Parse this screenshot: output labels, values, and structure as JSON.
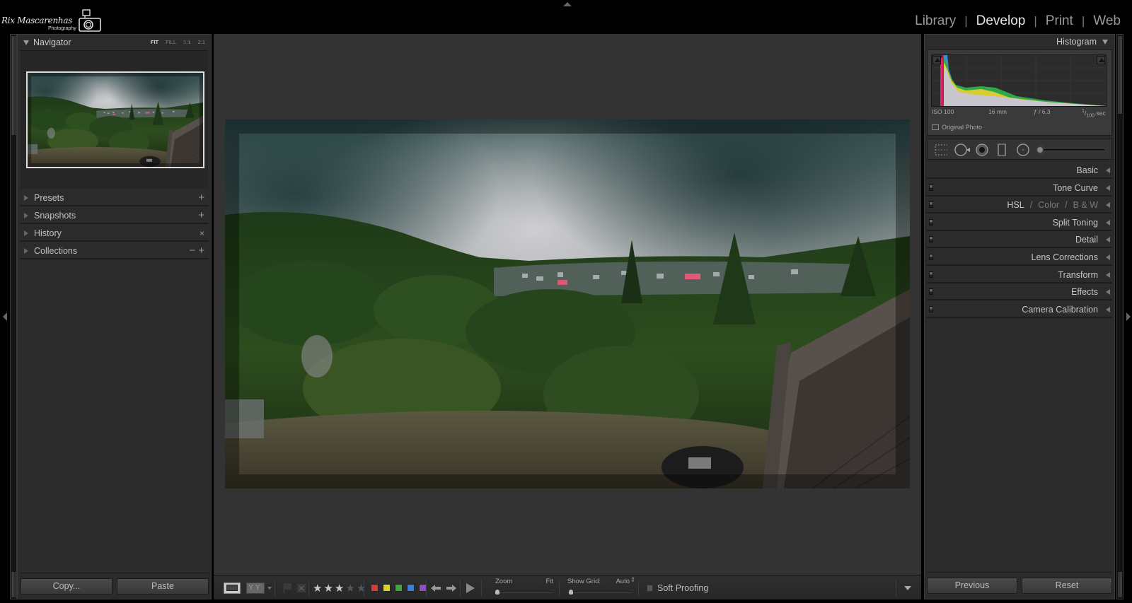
{
  "app": {
    "logo_name": "Rix Mascarenhas",
    "logo_sub": "Photography"
  },
  "modules": [
    {
      "label": "Library",
      "active": false
    },
    {
      "label": "Develop",
      "active": true
    },
    {
      "label": "Print",
      "active": false
    },
    {
      "label": "Web",
      "active": false
    }
  ],
  "left_panel": {
    "navigator": {
      "title": "Navigator",
      "zoom_options": [
        "FIT",
        "FILL",
        "1:1",
        "2:1"
      ],
      "zoom_selected": "FIT"
    },
    "sections": [
      {
        "label": "Presets",
        "action": "+"
      },
      {
        "label": "Snapshots",
        "action": "+"
      },
      {
        "label": "History",
        "action": "×"
      },
      {
        "label": "Collections",
        "action": "− +"
      }
    ],
    "copy_label": "Copy...",
    "paste_label": "Paste"
  },
  "right_panel": {
    "histogram_title": "Histogram",
    "exif": {
      "iso": "ISO 100",
      "focal": "16 mm",
      "aperture": "ƒ / 6,3",
      "shutter_num": "1",
      "shutter_den": "100",
      "shutter_unit": "sec"
    },
    "original_photo_label": "Original Photo",
    "tools": [
      "crop-overlay",
      "spot-removal",
      "red-eye",
      "graduated-filter",
      "radial-filter",
      "adjustment-brush"
    ],
    "sections": [
      {
        "label": "Basic",
        "has_switch": false
      },
      {
        "label": "Tone Curve",
        "has_switch": true
      },
      {
        "label": "HSL",
        "has_switch": true
      },
      {
        "label": "Split Toning",
        "has_switch": true
      },
      {
        "label": "Detail",
        "has_switch": true
      },
      {
        "label": "Lens Corrections",
        "has_switch": true
      },
      {
        "label": "Transform",
        "has_switch": true
      },
      {
        "label": "Effects",
        "has_switch": true
      },
      {
        "label": "Camera Calibration",
        "has_switch": true
      }
    ],
    "hsl_parts": [
      "HSL",
      "/",
      "Color",
      "/",
      "B & W"
    ],
    "previous_label": "Previous",
    "reset_label": "Reset"
  },
  "toolbar": {
    "rating": 3,
    "rating_max": 5,
    "color_labels": [
      "#d8393c",
      "#d8d034",
      "#3ca83c",
      "#3b7fd6",
      "#8a4fc9"
    ],
    "zoom_label": "Zoom",
    "zoom_value": "Fit",
    "show_grid_label": "Show Grid:",
    "show_grid_value": "Auto",
    "soft_proofing_label": "Soft Proofing",
    "soft_proofing_checked": false
  },
  "colors": {
    "panel_bg": "#2b2b2b",
    "center_bg": "#333333",
    "active_module": "#e6e6e6"
  }
}
